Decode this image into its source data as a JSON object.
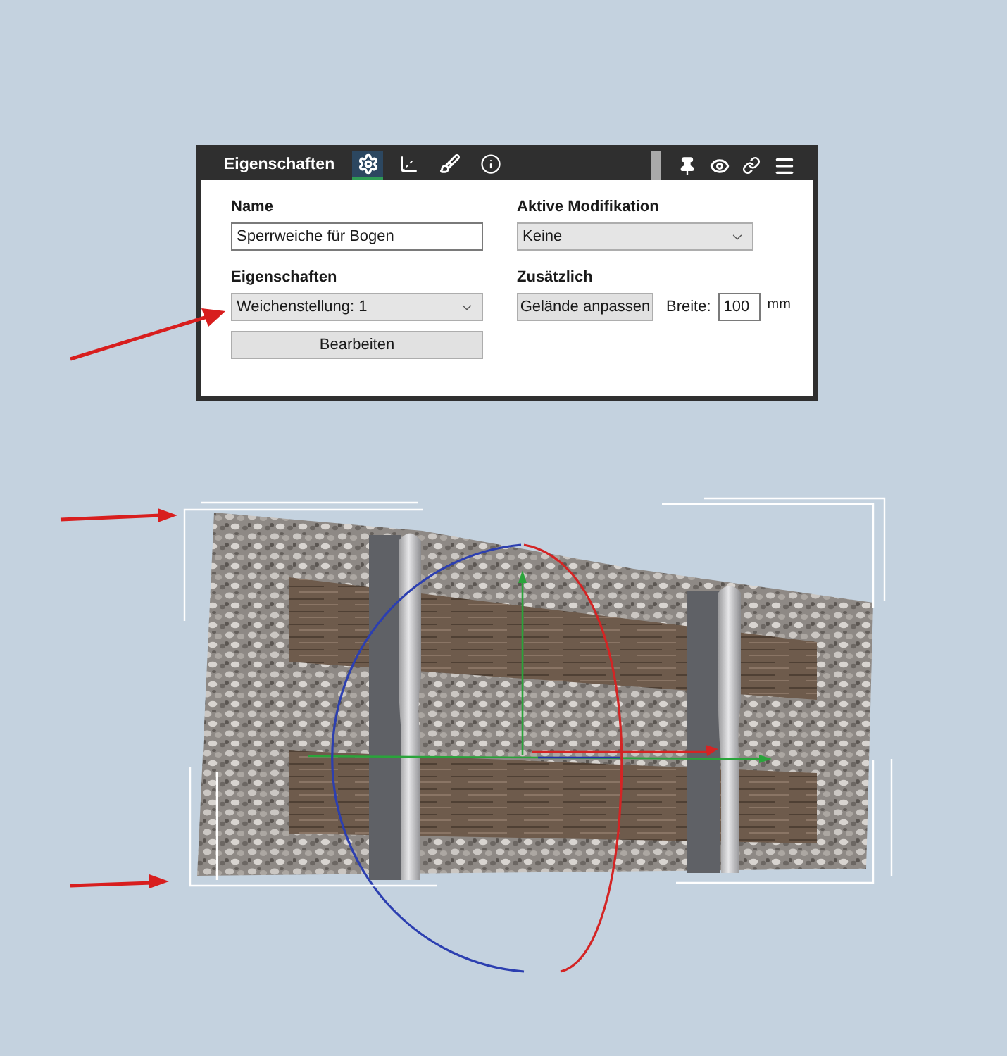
{
  "panel": {
    "title": "Eigenschaften",
    "tabs": [
      {
        "kind": "settings",
        "selected": true
      },
      {
        "kind": "axes",
        "selected": false
      },
      {
        "kind": "paint",
        "selected": false
      },
      {
        "kind": "info",
        "selected": false
      }
    ],
    "name": {
      "label": "Name",
      "value": "Sperrweiche für Bogen"
    },
    "active_modification": {
      "label": "Aktive Modifikation",
      "value": "Keine"
    },
    "properties": {
      "label": "Eigenschaften",
      "value": "Weichenstellung: 1",
      "button": "Bearbeiten"
    },
    "additional": {
      "label": "Zusätzlich",
      "button": "Gelände anpassen",
      "width_label": "Breite:",
      "width_value": "100",
      "unit": "mm"
    }
  }
}
